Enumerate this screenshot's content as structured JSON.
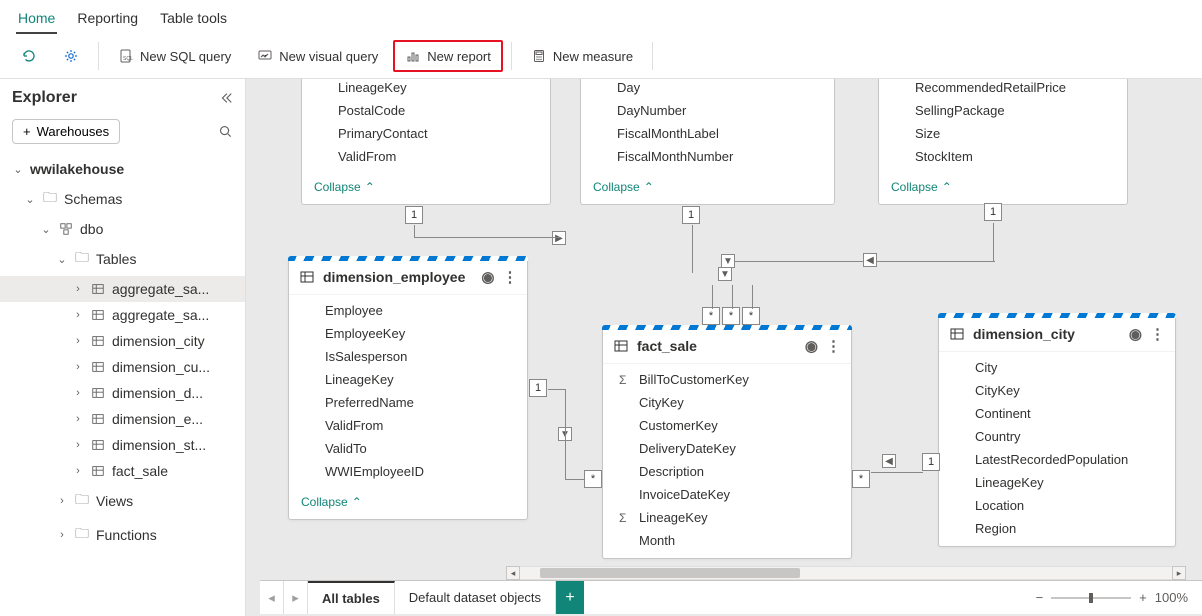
{
  "ribbon": {
    "tabs": [
      "Home",
      "Reporting",
      "Table tools"
    ],
    "active": "Home"
  },
  "toolbar": {
    "refresh_label": "",
    "settings_label": "",
    "new_sql_label": "New SQL query",
    "new_visual_label": "New visual query",
    "new_report_label": "New report",
    "new_measure_label": "New measure"
  },
  "explorer": {
    "title": "Explorer",
    "add_warehouses_label": "Warehouses",
    "root": "wwilakehouse",
    "schemas_label": "Schemas",
    "dbo_label": "dbo",
    "tables_label": "Tables",
    "tables": [
      "aggregate_sa...",
      "aggregate_sa...",
      "dimension_city",
      "dimension_cu...",
      "dimension_d...",
      "dimension_e...",
      "dimension_st...",
      "fact_sale"
    ],
    "views_label": "Views",
    "functions_label": "Functions"
  },
  "cards": {
    "trunc_a": {
      "fields": [
        "LineageKey",
        "PostalCode",
        "PrimaryContact",
        "ValidFrom"
      ],
      "collapse": "Collapse"
    },
    "trunc_b": {
      "fields": [
        "Day",
        "DayNumber",
        "FiscalMonthLabel",
        "FiscalMonthNumber"
      ],
      "collapse": "Collapse"
    },
    "trunc_c": {
      "fields": [
        "RecommendedRetailPrice",
        "SellingPackage",
        "Size",
        "StockItem"
      ],
      "collapse": "Collapse"
    },
    "dim_employee": {
      "title": "dimension_employee",
      "fields": [
        "Employee",
        "EmployeeKey",
        "IsSalesperson",
        "LineageKey",
        "PreferredName",
        "ValidFrom",
        "ValidTo",
        "WWIEmployeeID"
      ],
      "collapse": "Collapse"
    },
    "fact_sale": {
      "title": "fact_sale",
      "fields": [
        "BillToCustomerKey",
        "CityKey",
        "CustomerKey",
        "DeliveryDateKey",
        "Description",
        "InvoiceDateKey",
        "LineageKey",
        "Month"
      ],
      "sigma_idx": [
        0,
        6
      ]
    },
    "dim_city": {
      "title": "dimension_city",
      "fields": [
        "City",
        "CityKey",
        "Continent",
        "Country",
        "LatestRecordedPopulation",
        "LineageKey",
        "Location",
        "Region"
      ]
    }
  },
  "bottom": {
    "all_tables": "All tables",
    "default_dataset": "Default dataset objects",
    "zoom_pct": "100%"
  }
}
